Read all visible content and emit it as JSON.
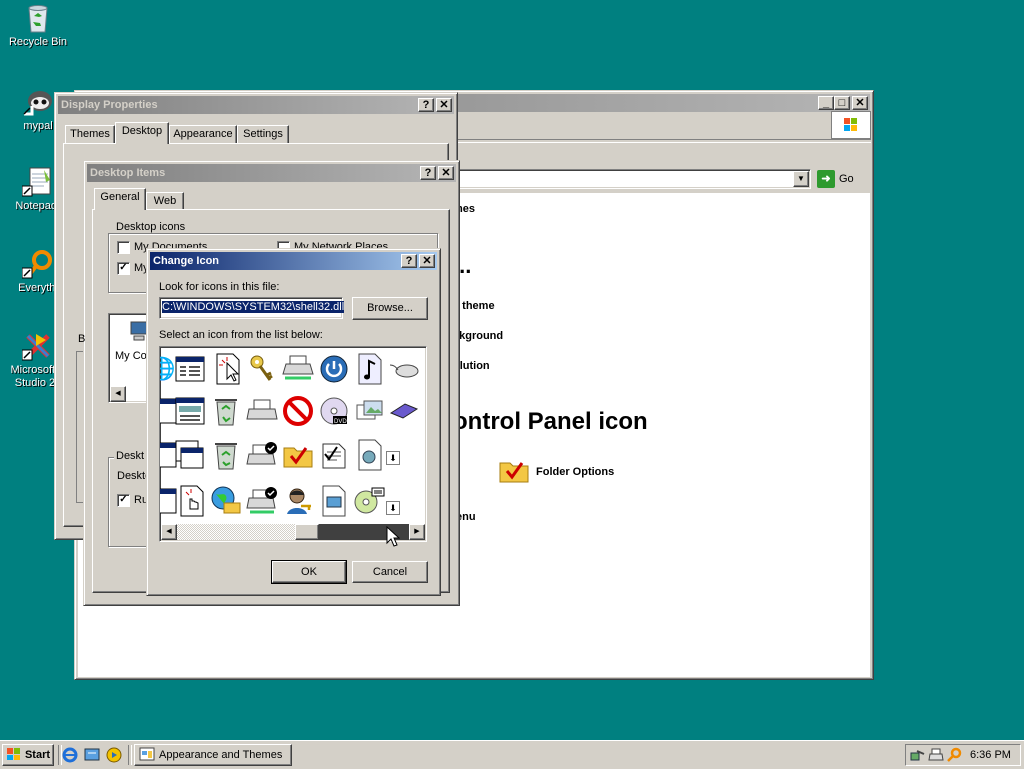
{
  "desktop": {
    "icons": [
      {
        "label": "Recycle Bin"
      },
      {
        "label": "mypal"
      },
      {
        "label": "Notepad-"
      },
      {
        "label": "Everythi"
      },
      {
        "label": "Microsoft V\nStudio 20"
      }
    ]
  },
  "explorer": {
    "go_label": "Go",
    "items": {
      "themes_partial": "mes",
      "ellipsis": "...",
      "theme_partial": "s theme",
      "background_partial": "ckground",
      "resolution_partial": "olution",
      "heading": "ontrol Panel icon",
      "folder_options": "Folder Options",
      "menu_partial": "lenu"
    }
  },
  "display_properties": {
    "title": "Display Properties",
    "tabs": [
      "Themes",
      "Desktop",
      "Appearance",
      "Settings"
    ],
    "behind_b": "B",
    "my_co": "My Co"
  },
  "desktop_items": {
    "title": "Desktop Items",
    "tabs": [
      "General",
      "Web"
    ],
    "group_icons": "Desktop icons",
    "my_documents": "My Documents",
    "my_network_places": "My Network Places",
    "my_partial": "My",
    "desktop_group_partial": "Deskt",
    "desktop_partial": "Deskto",
    "run_partial": "Ru"
  },
  "change_icon": {
    "title": "Change Icon",
    "look_label": "Look for icons in this file:",
    "file_value": "C:\\WINDOWS\\SYSTEM32\\shell32.dll",
    "browse_label": "Browse...",
    "select_label": "Select an icon from the list below:",
    "ok_label": "OK",
    "cancel_label": "Cancel"
  },
  "taskbar": {
    "start_label": "Start",
    "task_label": "Appearance and Themes",
    "clock": "6:36 PM"
  },
  "colors": {
    "desktop": "#008080",
    "active_title": "#0a246a",
    "inactive_title": "#808080",
    "face": "#d4d0c8"
  }
}
